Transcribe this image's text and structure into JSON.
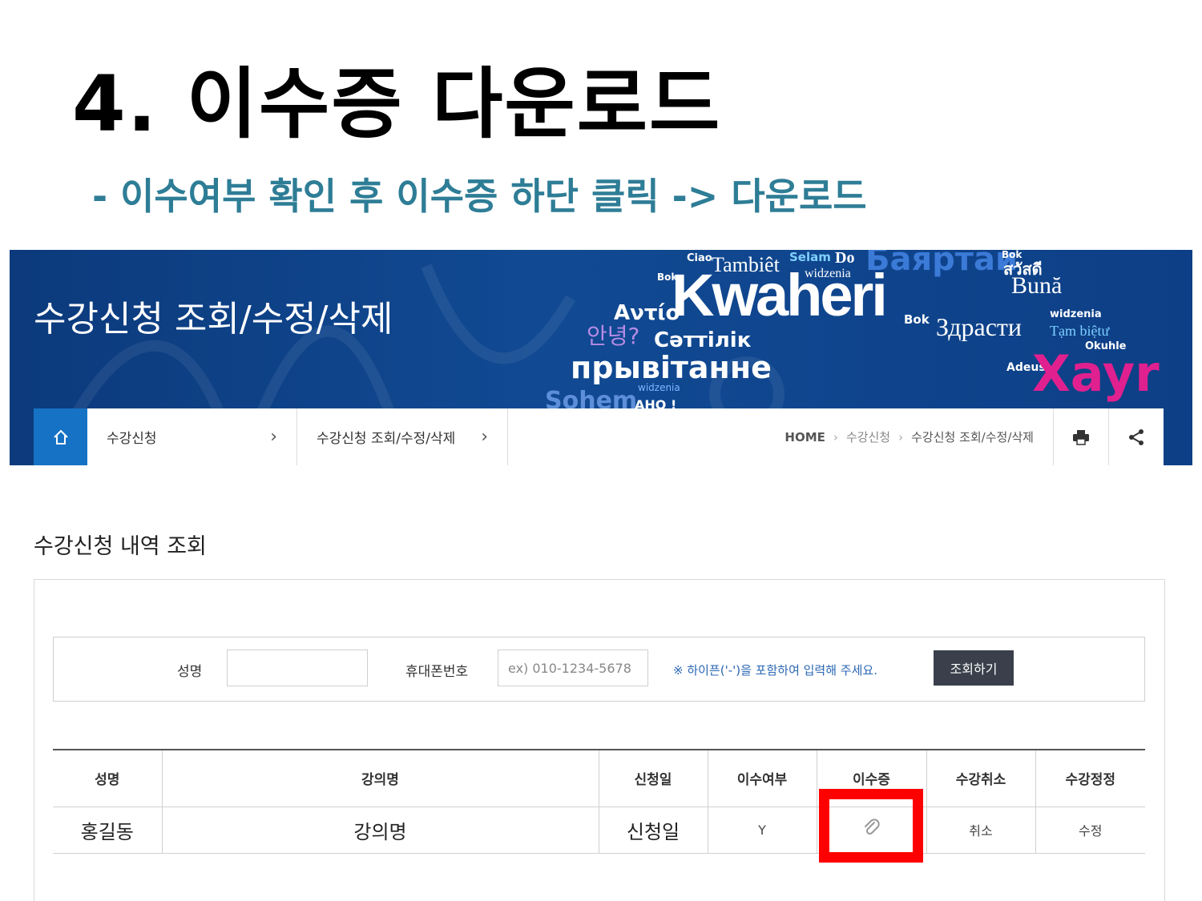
{
  "slide": {
    "title": "4. 이수증 다운로드",
    "subtitle": "- 이수여부 확인 후 이수증 하단 클릭 -> 다운로드"
  },
  "banner": {
    "title": "수강신청 조회/수정/삭제",
    "word_cloud": {
      "kwaheri": "Kwaheri",
      "tambiet": "Tambiêt",
      "selam": "Selam",
      "do": "Do",
      "widzenia": "widzenia",
      "bayrtai": "Баяртай",
      "buna": "Bună",
      "avtio": "Αντίο",
      "annyeong": "안녕?",
      "saytilik": "Сәттілік",
      "pryvitannie": "прывітанне",
      "zdrasti": "Здрасти",
      "tambietu": "Tạm biệtư",
      "xayr": "Xayr",
      "adeus": "Adeus",
      "ciao": "Ciao",
      "bok": "Bok",
      "okuhle": "Okuhle",
      "sawasdee": "สวัสดี",
      "sohem": "Sohem",
      "aho": "AHO !"
    },
    "colors": {
      "bg": "#0d3f86",
      "home": "#1672c4",
      "magenta": "#e0208f",
      "violet": "#b68be6"
    }
  },
  "breadcrumb": {
    "home_icon": "home-icon",
    "level1": "수강신청",
    "level2": "수강신청 조회/수정/삭제",
    "path": {
      "home": "HOME",
      "mid": "수강신청",
      "current": "수강신청 조회/수정/삭제"
    },
    "print_icon": "print-icon",
    "share_icon": "share-icon"
  },
  "section": {
    "title": "수강신청 내역 조회"
  },
  "search": {
    "name_label": "성명",
    "name_value": "",
    "phone_label": "휴대폰번호",
    "phone_placeholder": "ex) 010-1234-5678",
    "note": "※ 하이픈('-')을 포함하여 입력해 주세요.",
    "button": "조회하기"
  },
  "table": {
    "headers": [
      "성명",
      "강의명",
      "신청일",
      "이수여부",
      "이수증",
      "수강취소",
      "수강정정"
    ],
    "rows": [
      {
        "name": "홍길동",
        "course": "강의명",
        "date": "신청일",
        "completed": "Y",
        "certificate_icon": "paperclip-icon",
        "cancel": "취소",
        "edit": "수정"
      }
    ]
  },
  "annotation": {
    "highlight_color": "#ff0000",
    "target": "이수증"
  }
}
